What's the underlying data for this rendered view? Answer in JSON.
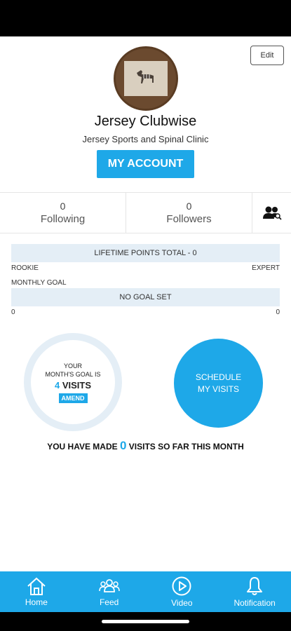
{
  "profile": {
    "edit_label": "Edit",
    "name": "Jersey Clubwise",
    "clinic": "Jersey Sports and Spinal Clinic",
    "account_button": "MY ACCOUNT"
  },
  "stats": {
    "following_count": "0",
    "following_label": "Following",
    "followers_count": "0",
    "followers_label": "Followers"
  },
  "points": {
    "lifetime_label": "LIFETIME POINTS TOTAL - 0",
    "rookie": "ROOKIE",
    "expert": "EXPERT",
    "monthly_goal_label": "MONTHLY GOAL",
    "no_goal": "NO GOAL SET",
    "min": "0",
    "max": "0"
  },
  "goal": {
    "line1": "YOUR",
    "line2": "MONTH'S GOAL IS",
    "value": "4",
    "unit": " VISITS",
    "amend": "AMEND",
    "schedule_line1": "SCHEDULE",
    "schedule_line2": "MY VISITS",
    "made_prefix": "YOU HAVE MADE ",
    "made_count": "0",
    "made_suffix": " VISITS SO FAR THIS MONTH"
  },
  "tabs": {
    "home": "Home",
    "feed": "Feed",
    "video": "Video",
    "notification": "Notification"
  },
  "colors": {
    "accent": "#1ea8e8",
    "light_bar": "#e4eef6"
  }
}
